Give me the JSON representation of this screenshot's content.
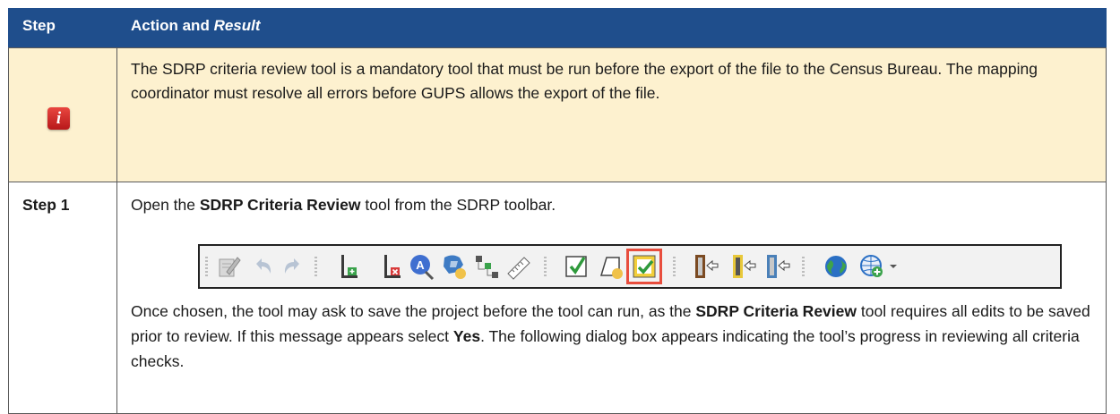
{
  "table": {
    "header": {
      "step_label": "Step",
      "action_label": "Action and ",
      "result_label": "Result"
    },
    "note_row": {
      "icon": "info-icon",
      "text": "The SDRP criteria review tool is a mandatory tool that must be run before the export of the file to the Census Bureau. The mapping coordinator must resolve all errors before GUPS allows the export of the file."
    },
    "step1": {
      "label": "Step 1",
      "line1_before": "Open the ",
      "line1_bold": "SDRP Criteria Review",
      "line1_after": " tool from the SDRP toolbar.",
      "para2_a": "Once chosen, the tool may ask to save the project before the tool can run, as the ",
      "para2_b_bold": "SDRP Criteria Review",
      "para2_c": " tool requires all edits to be saved prior to review. If this message appears select ",
      "para2_d_bold": "Yes",
      "para2_e": ". The following dialog box appears indicating the tool’s progress in reviewing all criteria checks."
    }
  },
  "toolbar": {
    "icons": [
      "edit-icon",
      "undo-icon",
      "redo-icon",
      "add-layer-icon",
      "remove-layer-icon",
      "attribute-search-icon",
      "block-assign-icon",
      "topology-icon",
      "measure-icon",
      "check-icon",
      "new-shape-icon",
      "criteria-review-icon",
      "export-icon",
      "export-zip-icon",
      "export-arrow-icon",
      "globe-icon",
      "add-globe-icon"
    ],
    "accent": "#e84d3d"
  }
}
